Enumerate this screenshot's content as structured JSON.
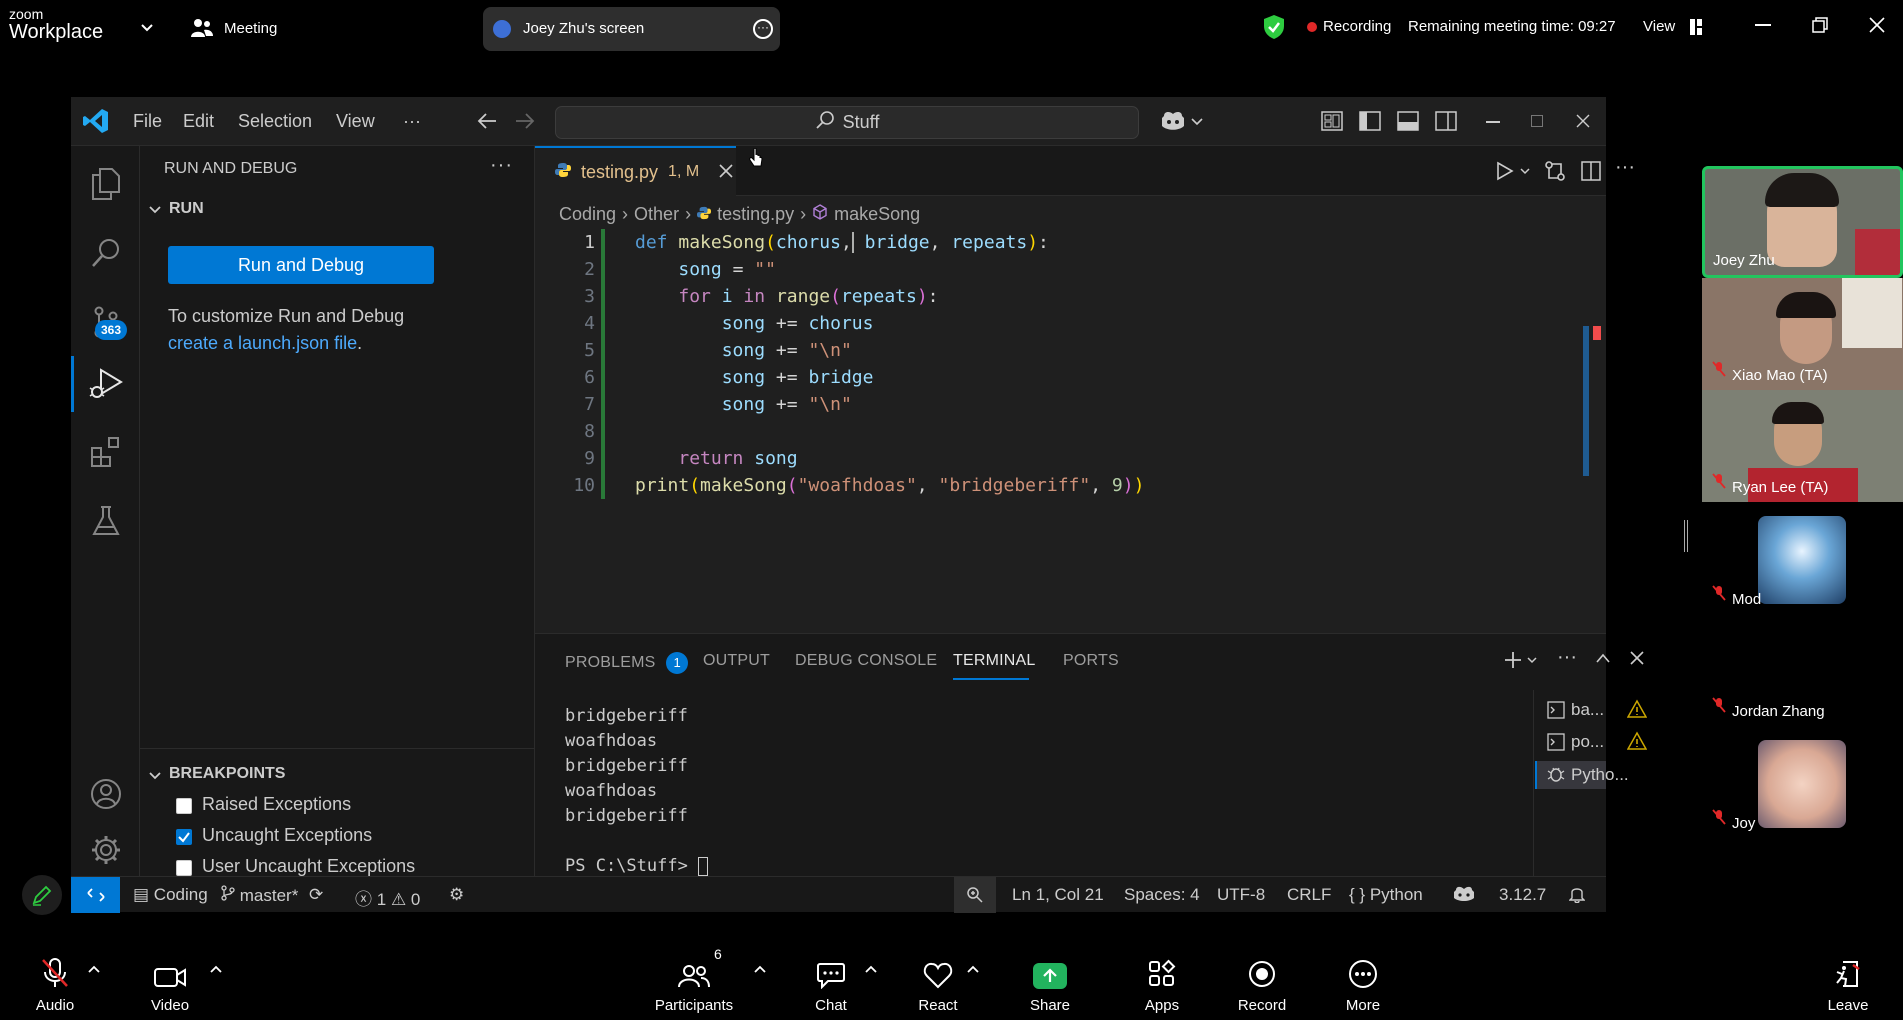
{
  "zoom": {
    "logo_top": "zoom",
    "logo_bottom": "Workplace",
    "meeting_label": "Meeting",
    "screen_share_label": "Joey Zhu's screen",
    "recording_label": "Recording",
    "remaining_time": "Remaining meeting time: 09:27",
    "view_label": "View",
    "toolbar": {
      "audio": "Audio",
      "video": "Video",
      "participants": "Participants",
      "participants_count": "6",
      "chat": "Chat",
      "react": "React",
      "share": "Share",
      "apps": "Apps",
      "record": "Record",
      "more": "More",
      "leave": "Leave"
    },
    "participants": [
      {
        "name": "Joey Zhu",
        "muted": false,
        "active_speaker": true
      },
      {
        "name": "Xiao Mao (TA)",
        "muted": true
      },
      {
        "name": "Ryan Lee (TA)",
        "muted": true
      },
      {
        "name": "Mod",
        "muted": true
      },
      {
        "name": "Jordan Zhang",
        "muted": true
      },
      {
        "name": "Joy",
        "muted": true
      }
    ],
    "colors": {
      "share_green": "#22b35e",
      "recording_red": "#e02828",
      "shield_green": "#2ecc40",
      "speaker_border": "#22c55e"
    }
  },
  "vscode": {
    "menu": [
      "File",
      "Edit",
      "Selection",
      "View",
      "···"
    ],
    "search_text": "Stuff",
    "activity_badge": "363",
    "sidebar": {
      "title": "RUN AND DEBUG",
      "section_run": "RUN",
      "run_button": "Run and Debug",
      "customize_text": "To customize Run and Debug",
      "launch_link": "create a launch.json file",
      "launch_link_suffix": ".",
      "breakpoints_title": "BREAKPOINTS",
      "breakpoints": [
        {
          "label": "Raised Exceptions",
          "checked": false
        },
        {
          "label": "Uncaught Exceptions",
          "checked": true
        },
        {
          "label": "User Uncaught Exceptions",
          "checked": false
        }
      ]
    },
    "tab": {
      "filename": "testing.py",
      "status": "1, M"
    },
    "breadcrumb": [
      "Coding",
      "Other",
      "testing.py",
      "makeSong"
    ],
    "line_numbers": [
      "1",
      "2",
      "3",
      "4",
      "5",
      "6",
      "7",
      "8",
      "9",
      "10"
    ],
    "panel": {
      "tabs": [
        "PROBLEMS",
        "OUTPUT",
        "DEBUG CONSOLE",
        "TERMINAL",
        "PORTS"
      ],
      "problems_count": "1",
      "terminal_lines": [
        "bridgeberiff",
        "woafhdoas",
        "bridgeberiff",
        "woafhdoas",
        "bridgeberiff",
        "",
        "PS C:\\Stuff> "
      ],
      "terminal_list": [
        "ba...",
        "po...",
        "Pytho..."
      ]
    },
    "status": {
      "branch_root": "Coding",
      "branch": "master*",
      "errors": "1",
      "warnings": "0",
      "position": "Ln 1, Col 21",
      "spaces": "Spaces: 4",
      "encoding": "UTF-8",
      "eol": "CRLF",
      "language": "Python",
      "version": "3.12.7"
    }
  }
}
